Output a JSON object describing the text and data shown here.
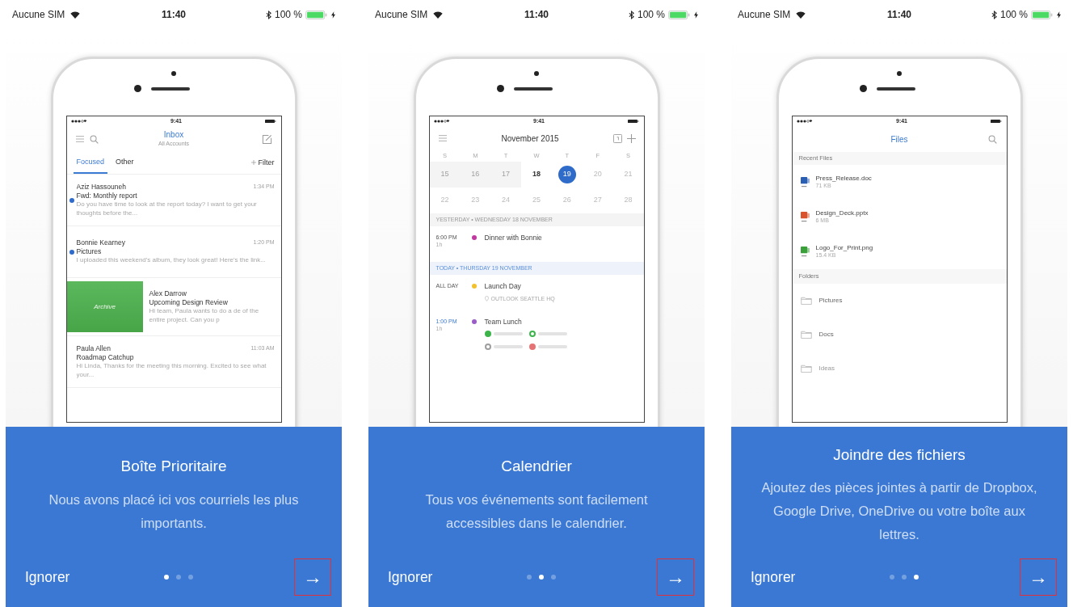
{
  "screens": [
    {
      "status": {
        "carrier": "Aucune SIM",
        "time": "11:40",
        "battery": "100 %"
      },
      "phone": {
        "kind": "inbox",
        "time": "9:41",
        "title": "Inbox",
        "subtitle": "All Accounts",
        "tabs": [
          {
            "label": "Focused",
            "selected": true
          },
          {
            "label": "Other",
            "selected": false
          }
        ],
        "filter": "Filter",
        "messages": [
          {
            "sender": "Aziz Hassouneh",
            "time": "1:34 PM",
            "subject": "Fwd: Monthly report",
            "preview": "Do you have time to look at the report today? I want to get your thoughts before the...",
            "unread": true,
            "swiped": false
          },
          {
            "sender": "Bonnie Kearney",
            "time": "1:20 PM",
            "subject": "Pictures",
            "preview": "I uploaded this weekend's album, they look great! Here's the link...",
            "unread": true,
            "swiped": false
          },
          {
            "sender": "Alex Darrow",
            "subject": "Upcoming Design Review",
            "preview": "Hi team, Paula wants to do a de of the entire project. Can you p",
            "unread": false,
            "swiped": true,
            "action": "Archive"
          },
          {
            "sender": "Paula Allen",
            "time": "11:03 AM",
            "subject": "Roadmap Catchup",
            "preview": "Hi Linda, Thanks for the meeting this morning. Excited to see what your...",
            "unread": false,
            "swiped": false
          }
        ]
      },
      "card": {
        "title": "Boîte Prioritaire",
        "description": "Nous avons placé ici vos courriels les plus importants.",
        "skip": "Ignorer",
        "next": "→",
        "next_highlighted": true,
        "dots": [
          {
            "selected": true
          },
          {
            "selected": false
          },
          {
            "selected": false
          }
        ]
      }
    },
    {
      "status": {
        "carrier": "Aucune SIM",
        "time": "11:40",
        "battery": "100 %"
      },
      "phone": {
        "kind": "calendar",
        "time": "9:41",
        "title": "November 2015",
        "weekdays": [
          "S",
          "M",
          "T",
          "W",
          "T",
          "F",
          "S"
        ],
        "weeks": [
          [
            {
              "label": "15",
              "kind": "past",
              "selected": false
            },
            {
              "label": "16",
              "kind": "past",
              "selected": false
            },
            {
              "label": "17",
              "kind": "past",
              "selected": false
            },
            {
              "label": "18",
              "kind": "bold",
              "selected": false
            },
            {
              "label": "19",
              "kind": "plain",
              "selected": true
            },
            {
              "label": "20",
              "kind": "plain",
              "selected": false
            },
            {
              "label": "21",
              "kind": "plain",
              "selected": false
            }
          ],
          [
            {
              "label": "22",
              "kind": "plain",
              "selected": false
            },
            {
              "label": "23",
              "kind": "plain",
              "selected": false
            },
            {
              "label": "24",
              "kind": "plain",
              "selected": false
            },
            {
              "label": "25",
              "kind": "plain",
              "selected": false
            },
            {
              "label": "26",
              "kind": "plain",
              "selected": false
            },
            {
              "label": "27",
              "kind": "plain",
              "selected": false
            },
            {
              "label": "28",
              "kind": "plain",
              "selected": false
            }
          ]
        ],
        "agenda": [
          {
            "kind": "header",
            "label": "YESTERDAY • WEDNESDAY 18 NOVEMBER",
            "today": false
          },
          {
            "kind": "event",
            "time": "6:00 PM",
            "duration": "1h",
            "title": "Dinner with Bonnie",
            "color": "#c0399f",
            "now": false
          },
          {
            "kind": "header",
            "label": "TODAY • THURSDAY 19 NOVEMBER",
            "today": true
          },
          {
            "kind": "event",
            "time": "ALL DAY",
            "title": "Launch Day",
            "location": "OUTLOOK SEATTLE HQ",
            "color": "#f2c12e",
            "now": false
          },
          {
            "kind": "event",
            "time": "1:00 PM",
            "duration": "1h",
            "title": "Team Lunch",
            "color": "#9a5cc6",
            "now": true,
            "attendees": [
              {
                "color": "#3cb44b",
                "accepted": true
              },
              {
                "color": "#3cb44b",
                "accepted": false
              },
              {
                "color": "#9e9e9e",
                "accepted": false
              },
              {
                "color": "#e57373",
                "accepted": true
              }
            ]
          }
        ]
      },
      "card": {
        "title": "Calendrier",
        "description": "Tous vos événements sont facilement accessibles dans le calendrier.",
        "skip": "Ignorer",
        "next": "→",
        "next_highlighted": true,
        "dots": [
          {
            "selected": false
          },
          {
            "selected": true
          },
          {
            "selected": false
          }
        ]
      }
    },
    {
      "status": {
        "carrier": "Aucune SIM",
        "time": "11:40",
        "battery": "100 %"
      },
      "phone": {
        "kind": "files",
        "time": "9:41",
        "title": "Files",
        "recent_label": "Recent Files",
        "files": [
          {
            "name": "Press_Release.doc",
            "size": "71 KB",
            "color": "#2b5fb4"
          },
          {
            "name": "Design_Deck.pptx",
            "size": "6 MB",
            "color": "#d9532c"
          },
          {
            "name": "Logo_For_Print.png",
            "size": "15.4 KB",
            "color": "#3aa03a"
          }
        ],
        "folders_label": "Folders",
        "folders": [
          "Pictures",
          "Docs",
          "Ideas"
        ]
      },
      "card": {
        "title": "Joindre des fichiers",
        "description": "Ajoutez des pièces jointes à partir de Dropbox, Google Drive, OneDrive ou votre boîte aux lettres.",
        "skip": "Ignorer",
        "next": "→",
        "next_highlighted": true,
        "dots": [
          {
            "selected": false
          },
          {
            "selected": false
          },
          {
            "selected": true
          }
        ]
      }
    }
  ]
}
